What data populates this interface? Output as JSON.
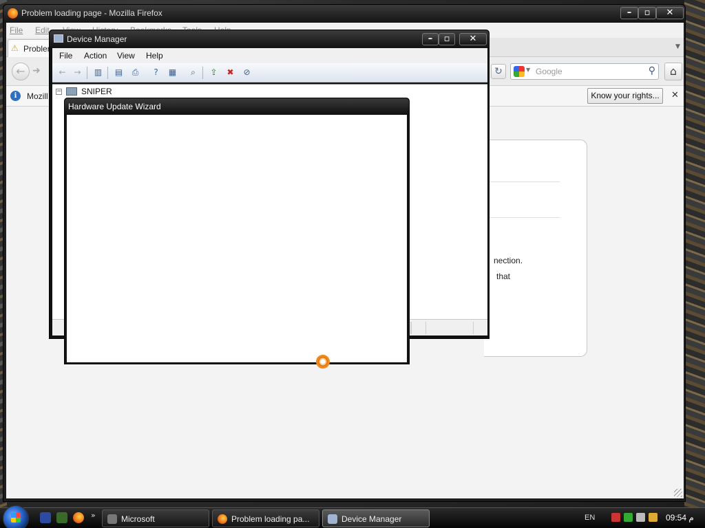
{
  "firefox": {
    "window_title": "Problem loading page - Mozilla Firefox",
    "menu": [
      "File",
      "Edit",
      "View",
      "History",
      "Bookmarks",
      "Tools",
      "Help"
    ],
    "tab_label": "Probler",
    "search": {
      "placeholder": "Google",
      "engine_icon": "google-icon"
    },
    "notice": {
      "text": "Mozill",
      "button": "Know your rights...",
      "close": "✕"
    },
    "error_page": {
      "line1": "nection.",
      "line2": "that"
    }
  },
  "device_manager": {
    "window_title": "Device Manager",
    "menu": [
      "File",
      "Action",
      "View",
      "Help"
    ],
    "tree_root": "SNIPER",
    "toolbar_icons": [
      "back-icon",
      "forward-icon",
      "show-hide-tree-icon",
      "properties-icon",
      "print-icon",
      "help-icon",
      "console-icon",
      "scan-hardware-icon",
      "update-driver-icon",
      "uninstall-icon",
      "disable-icon"
    ]
  },
  "wizard": {
    "window_title": "Hardware Update Wizard"
  },
  "taskbar": {
    "quick_launch_more": "»",
    "tasks": [
      {
        "label": "Microsoft",
        "active": false
      },
      {
        "label": "Problem loading pa...",
        "active": false
      },
      {
        "label": "Device Manager",
        "active": true
      }
    ],
    "language": "EN",
    "clock": "09:54 م"
  },
  "colors": {
    "accent_orange": "#f08a1a",
    "titlebar_dark": "#141414",
    "info_blue": "#2f6fc0"
  }
}
